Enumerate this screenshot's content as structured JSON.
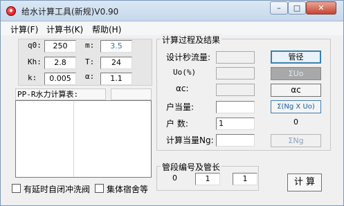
{
  "window": {
    "title": "给水计算工具(新规)V0.90",
    "min": "–",
    "max": "□",
    "close": "✕"
  },
  "menu": [
    "计算(F)",
    "计算书(K)",
    "帮助(H)"
  ],
  "params": {
    "q0": {
      "label": "q0:",
      "value": "250"
    },
    "m": {
      "label": "m:",
      "value": "3.5"
    },
    "kh": {
      "label": "Kh:",
      "value": "2.8"
    },
    "t": {
      "label": "T:",
      "value": "24"
    },
    "k": {
      "label": "k:",
      "value": "0.005"
    },
    "alpha": {
      "label": "α:",
      "value": "1.1"
    }
  },
  "table": {
    "header_left": "PP-R水力计算表:",
    "header_right": ""
  },
  "calc": {
    "group_title": "计算过程及结果",
    "design_flow_label": "设计秒流量:",
    "design_flow_value": "",
    "u0_label": "Uo(%)",
    "u0_value": "",
    "alphac_label": "αc:",
    "alphac_value": "",
    "household_eq_label": "户当量:",
    "household_eq_value": "",
    "households_label": "户  数:",
    "households_value": "1",
    "calc_eq_label": "计算当量Ng:",
    "calc_eq_value": "",
    "sum_value": "0",
    "btn_pipe": "管径",
    "btn_u0": "ΣUo",
    "btn_alphac": "αc",
    "btn_sum": "Σ(Ng X Uo)",
    "btn_ng": "ΣNg"
  },
  "segment": {
    "group_title": "管段编号及管长",
    "index": "0",
    "number": "1",
    "length": "1"
  },
  "calc_button": "计 算",
  "options": {
    "delay_valve": "有延时自闭冲洗阀",
    "dorm": "集体宿舍等"
  }
}
